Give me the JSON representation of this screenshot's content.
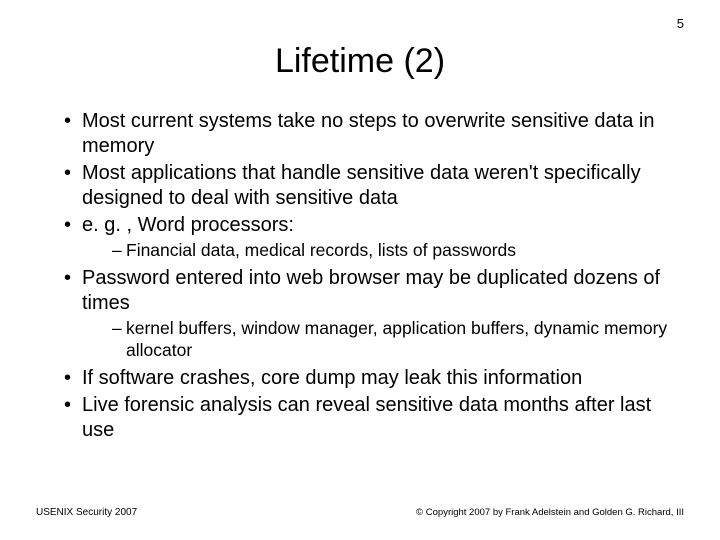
{
  "page_number": "5",
  "title": "Lifetime (2)",
  "bullets": [
    {
      "text": "Most current systems take no steps to overwrite sensitive data in memory",
      "sub": []
    },
    {
      "text": "Most applications that handle sensitive data weren't specifically designed to deal with sensitive data",
      "sub": []
    },
    {
      "text": "e. g. , Word processors:",
      "sub": [
        "Financial data, medical records, lists of passwords"
      ]
    },
    {
      "text": "Password entered into web browser may be duplicated dozens of times",
      "sub": [
        "kernel buffers, window manager, application buffers, dynamic memory allocator"
      ]
    },
    {
      "text": "If software crashes, core dump may leak this information",
      "sub": []
    },
    {
      "text": "Live forensic analysis can reveal sensitive data months after last use",
      "sub": []
    }
  ],
  "footer": {
    "left": "USENIX Security 2007",
    "right": "© Copyright 2007 by Frank Adelstein and Golden G. Richard, III"
  }
}
